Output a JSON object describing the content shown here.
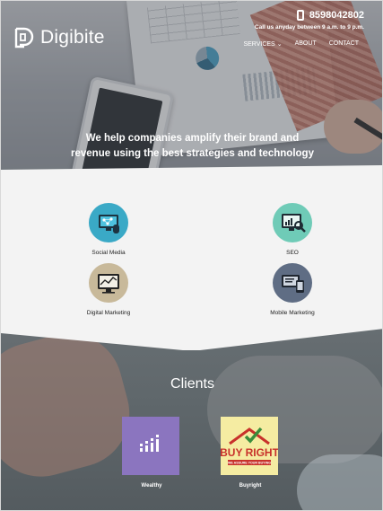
{
  "brand": {
    "name": "Digibite"
  },
  "contact": {
    "phone": "8598042802",
    "hours": "Call us anyday between 9 a.m. to 9 p.m."
  },
  "nav": [
    {
      "label": "SERVICES",
      "has_dropdown": true
    },
    {
      "label": "ABOUT"
    },
    {
      "label": "CONTACT"
    }
  ],
  "hero": {
    "tagline_line1": "We help companies amplify their brand and",
    "tagline_line2": "revenue using the best strategies and technology"
  },
  "services": [
    {
      "label": "Social Media",
      "color": "#3aa9c6",
      "icon": "social-media-icon"
    },
    {
      "label": "SEO",
      "color": "#6fcbb7",
      "icon": "seo-icon"
    },
    {
      "label": "Digital Marketing",
      "color": "#c8b99a",
      "icon": "digital-marketing-icon"
    },
    {
      "label": "Mobile Marketing",
      "color": "#5f6d84",
      "icon": "mobile-marketing-icon"
    }
  ],
  "clients": {
    "title": "Clients",
    "items": [
      {
        "name": "Wealthy",
        "color": "#8b75bf"
      },
      {
        "name": "Buyright",
        "logo_text": "BUY RIGHT",
        "logo_tagline": "WE ASSURE YOUR BUYING",
        "color": "#f5eca2"
      }
    ]
  }
}
